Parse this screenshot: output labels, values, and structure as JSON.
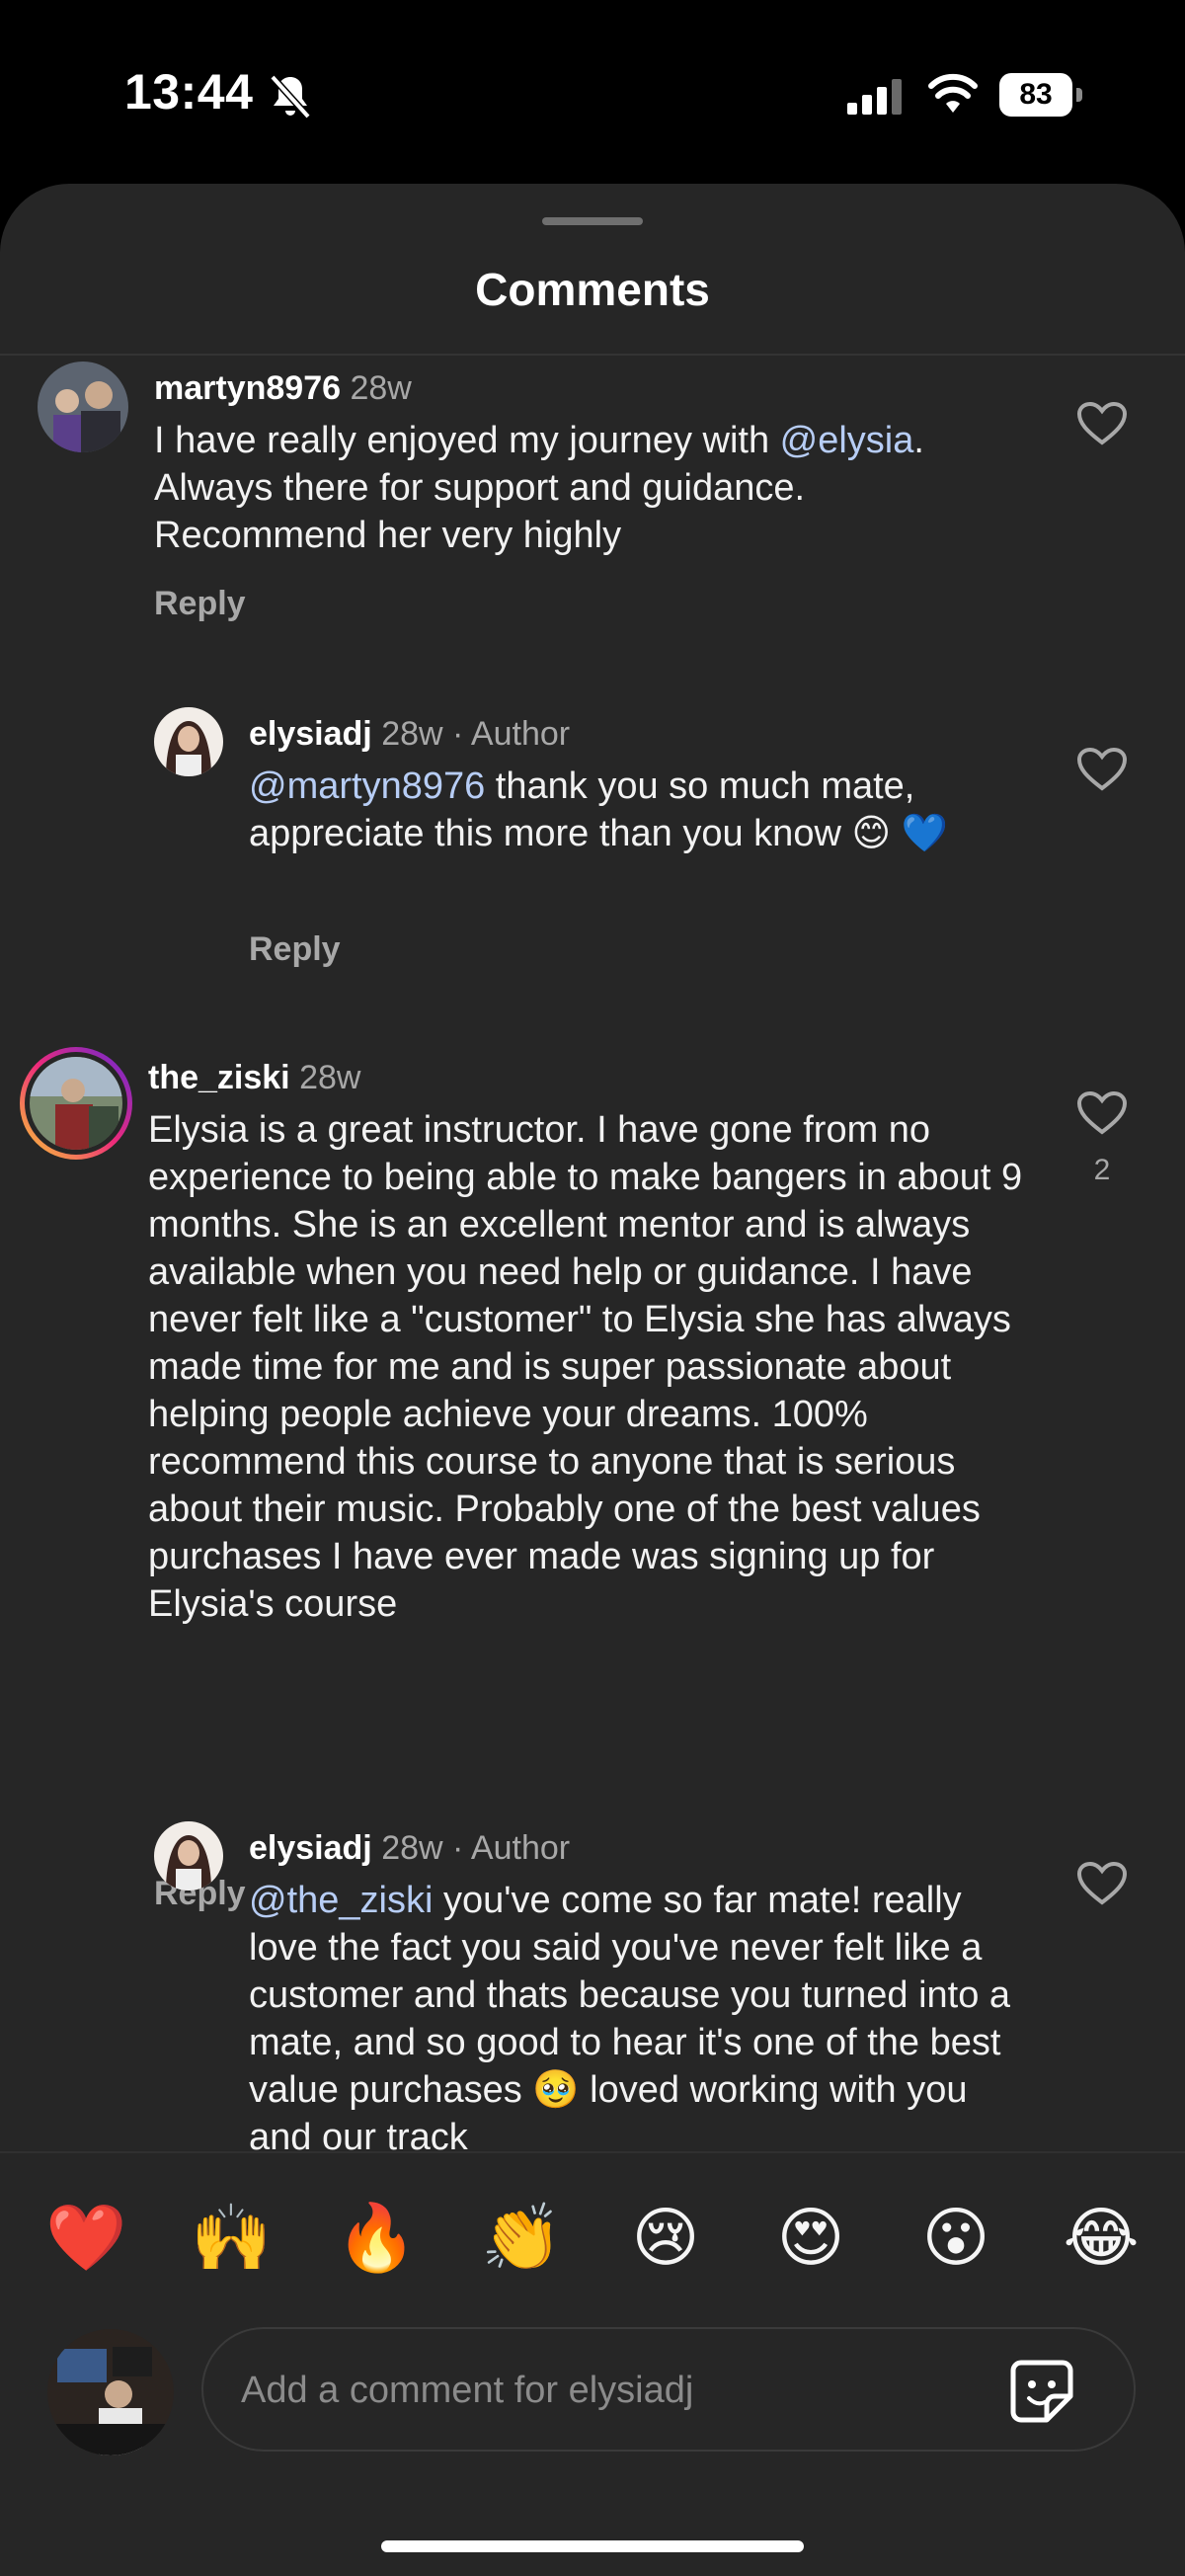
{
  "status_bar": {
    "time": "13:44",
    "battery": "83",
    "icons": [
      "bell-slash-icon",
      "cellular-signal-icon",
      "wifi-icon",
      "battery-icon"
    ]
  },
  "sheet": {
    "title": "Comments"
  },
  "comments": [
    {
      "username": "martyn8976",
      "meta": "28w",
      "text_before": "I have really enjoyed my journey with ",
      "mention": "@elysia",
      "text_after": ". Always there for support and guidance. Recommend her very highly",
      "reply_label": "Reply"
    },
    {
      "username": "elysiadj",
      "meta": "28w · Author",
      "mention": "@martyn8976",
      "text_after": " thank you so much mate, appreciate this more than you know 😊 💙",
      "reply_label": "Reply"
    },
    {
      "username": "the_ziski",
      "meta": "28w",
      "text": "Elysia is a great instructor. I have gone from no experience to being able to make bangers in about 9 months. She is an excellent mentor and is always available when you need help or guidance.  I have never felt like a \"customer\" to Elysia she has always made time for me and is super passionate about helping people achieve your dreams. 100% recommend this course to anyone that is serious about their music.  Probably one of the best values purchases I have ever made was signing up for Elysia's course",
      "likes": "2",
      "reply_label": "Reply"
    },
    {
      "username": "elysiadj",
      "meta": "28w · Author",
      "mention": "@the_ziski",
      "text_after": " you've come so far mate! really love the fact you said you've never felt like a customer and thats because you turned into a mate, and so good to hear it's one of the best value purchases 🥹 loved working with you and our track"
    }
  ],
  "emoji_bar": [
    "❤️",
    "🙌",
    "🔥",
    "👏",
    "😢",
    "😍",
    "😮",
    "😂"
  ],
  "composer": {
    "placeholder": "Add a comment for elysiadj"
  },
  "colors": {
    "background": "#000000",
    "sheet": "#262626",
    "mention": "#b7cdf5",
    "secondary_text": "#a8a8a8"
  }
}
